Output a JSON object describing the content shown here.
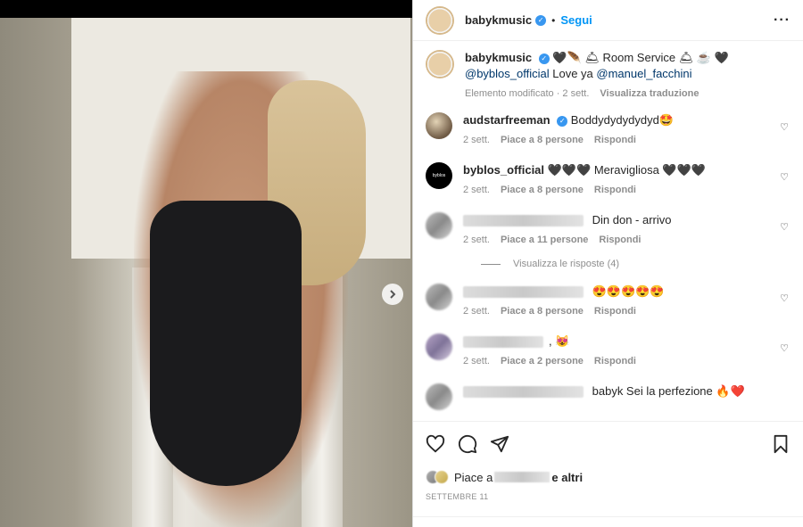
{
  "header": {
    "username": "babykmusic",
    "separator": "•",
    "follow_label": "Segui",
    "more_icon": "more-horizontal-icon"
  },
  "caption": {
    "username": "babykmusic",
    "text": "🖤🪶 🛎 Room Service 🛎 ☕ 🖤",
    "mention1": "@byblos_official",
    "mid": " Love ya ",
    "mention2": "@manuel_facchini",
    "edited": "Elemento modificato · 2 sett.",
    "translate": "Visualizza traduzione"
  },
  "comments": [
    {
      "username": "audstarfreeman",
      "text": "Boddydydydydyd🤩",
      "time": "2 sett.",
      "likes": "Piace a 8 persone",
      "reply": "Rispondi"
    },
    {
      "username": "byblos_official",
      "text": "🖤🖤🖤 Meravigliosa 🖤🖤🖤",
      "time": "2 sett.",
      "likes": "Piace a 8 persone",
      "reply": "Rispondi",
      "avatar_text": "byblos"
    },
    {
      "username": "",
      "text": "Din don - arrivo",
      "time": "2 sett.",
      "likes": "Piace a 11 persone",
      "reply": "Rispondi"
    },
    {
      "username": "",
      "text": "😍😍😍😍😍",
      "time": "2 sett.",
      "likes": "Piace a 8 persone",
      "reply": "Rispondi"
    },
    {
      "username": "",
      "text": ", 😻",
      "time": "2 sett.",
      "likes": "Piace a 2 persone",
      "reply": "Rispondi"
    },
    {
      "username": "",
      "text": "babyk Sei la perfezione 🔥❤️",
      "time": "",
      "likes": "",
      "reply": ""
    }
  ],
  "view_replies": "Visualizza le risposte (4)",
  "likes": {
    "prefix": "Piace a",
    "suffix": "e altri"
  },
  "date": "SETTEMBRE 11",
  "colors": {
    "link": "#0095f6",
    "mention": "#00376b",
    "verified": "#3897f0",
    "muted": "#8e8e8e"
  }
}
